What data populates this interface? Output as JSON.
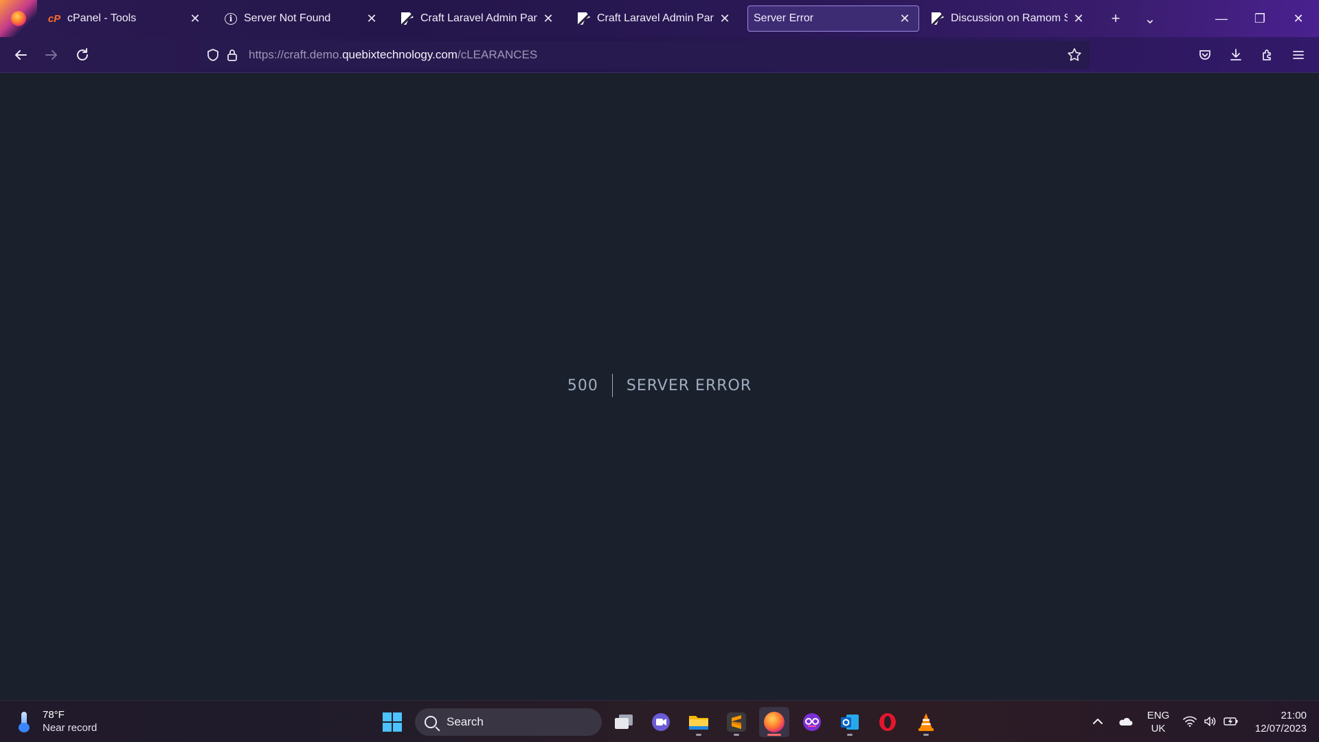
{
  "browser": {
    "tabs": [
      {
        "title": "cPanel - Tools",
        "favicon": "cpanel-icon",
        "favicon_text": "cP",
        "active": false
      },
      {
        "title": "Server Not Found",
        "favicon": "info-icon",
        "favicon_text": "i",
        "active": false
      },
      {
        "title": "Craft Laravel Admin Panel - ",
        "favicon": "craft-icon",
        "active": false
      },
      {
        "title": "Craft Laravel Admin Panel - ",
        "favicon": "craft-icon",
        "active": false
      },
      {
        "title": "Server Error",
        "favicon": "",
        "active": true
      },
      {
        "title": "Discussion on Ramom Scho",
        "favicon": "craft-icon",
        "active": false
      }
    ],
    "close_glyph": "✕",
    "new_tab_glyph": "+",
    "tab_list_glyph": "⌄",
    "window": {
      "minimize": "—",
      "restore": "❐",
      "close": "✕"
    },
    "url": {
      "prefix": "https://craft.demo.",
      "domain": "quebixtechnology.com",
      "path": "/cLEARANCES"
    }
  },
  "page": {
    "error_code": "500",
    "error_message": "Server Error"
  },
  "taskbar": {
    "weather": {
      "temp": "78°F",
      "desc": "Near record"
    },
    "search_label": "Search",
    "language": {
      "line1": "ENG",
      "line2": "UK"
    },
    "clock": {
      "time": "21:00",
      "date": "12/07/2023"
    }
  },
  "colors": {
    "page_background": "#1a202c",
    "error_text": "#a0aec0",
    "tabstrip": "#2b1a52",
    "active_tab": "#3d2b74"
  }
}
